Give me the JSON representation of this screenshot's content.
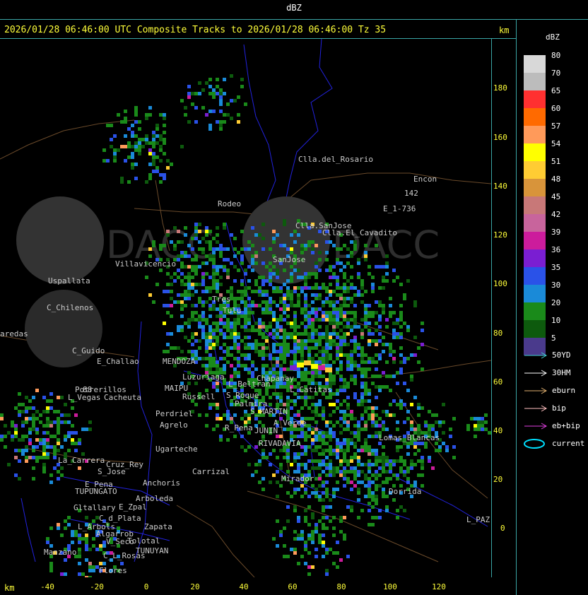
{
  "window": {
    "title": "dBZ"
  },
  "header": {
    "text": "2026/01/28 06:46:00 UTC Composite Tracks to 2026/01/28 06:46:00 Tz 35",
    "unit_top": "km",
    "unit_bottom": "km"
  },
  "axes": {
    "y_ticks": [
      "180",
      "160",
      "140",
      "120",
      "100",
      "80",
      "60",
      "40",
      "20",
      "0"
    ],
    "x_ticks": [
      "-40",
      "-20",
      "0",
      "20",
      "40",
      "60",
      "80",
      "100",
      "120"
    ]
  },
  "legend": {
    "title": "dBZ",
    "levels": [
      {
        "label": "80",
        "color": "#d8d8d8"
      },
      {
        "label": "70",
        "color": "#bcbcbc"
      },
      {
        "label": "65",
        "color": "#ff3030"
      },
      {
        "label": "60",
        "color": "#ff6a00"
      },
      {
        "label": "57",
        "color": "#ff9a5a"
      },
      {
        "label": "54",
        "color": "#ffff00"
      },
      {
        "label": "51",
        "color": "#ffcc33"
      },
      {
        "label": "48",
        "color": "#d8943a"
      },
      {
        "label": "45",
        "color": "#c87878"
      },
      {
        "label": "42",
        "color": "#c8649c"
      },
      {
        "label": "39",
        "color": "#cc1c9c"
      },
      {
        "label": "36",
        "color": "#7a1ed2"
      },
      {
        "label": "35",
        "color": "#2a52e8"
      },
      {
        "label": "30",
        "color": "#1a8ad8"
      },
      {
        "label": "20",
        "color": "#1a8a1a"
      },
      {
        "label": "10",
        "color": "#0d5a0d"
      },
      {
        "label": "5",
        "color": "#4a3a8c"
      }
    ]
  },
  "tracks": [
    {
      "label": "50YD",
      "color": "#40d0d0"
    },
    {
      "label": "30HM",
      "color": "#ffffff"
    },
    {
      "label": "eburn",
      "color": "#e0b070"
    },
    {
      "label": "bip",
      "color": "#ffc0c0"
    },
    {
      "label": "eb+bip",
      "color": "#e040e0"
    },
    {
      "label": "current",
      "color": "#00e0ff"
    }
  ],
  "map": {
    "logo_text_left": "DACC",
    "logo_text_right": "DACC",
    "places": [
      {
        "name": "Clla.del_Rosario"
      },
      {
        "name": "Encon"
      },
      {
        "name": "142"
      },
      {
        "name": "E_1-736"
      },
      {
        "name": "Rodeo"
      },
      {
        "name": "Clla.SanJose"
      },
      {
        "name": "Clla.El_Cavadito"
      },
      {
        "name": "SanJose"
      },
      {
        "name": "Villavicencio"
      },
      {
        "name": "Uspallata"
      },
      {
        "name": "C_Chilenos"
      },
      {
        "name": "aredas"
      },
      {
        "name": "Tres"
      },
      {
        "name": "Tulu"
      },
      {
        "name": "C_Guido"
      },
      {
        "name": "E_Challao"
      },
      {
        "name": "MENDOZA"
      },
      {
        "name": "Potrerillos"
      },
      {
        "name": "L_Vegas"
      },
      {
        "name": "Cacheuta"
      },
      {
        "name": "Luzuriaga"
      },
      {
        "name": "L_Beltran"
      },
      {
        "name": "Chapanay"
      },
      {
        "name": "L_Catitas"
      },
      {
        "name": "MAIPU"
      },
      {
        "name": "Russell"
      },
      {
        "name": "S_Roque"
      },
      {
        "name": "Palmira"
      },
      {
        "name": "S_MARTIN"
      },
      {
        "name": "Perdriel"
      },
      {
        "name": "Agrelo"
      },
      {
        "name": "A_Verde"
      },
      {
        "name": "R_Pena"
      },
      {
        "name": "JUNIN"
      },
      {
        "name": "Lomas_Blancas"
      },
      {
        "name": "Ugarteche"
      },
      {
        "name": "RIVADAVIA"
      },
      {
        "name": "La_Carrera"
      },
      {
        "name": "Cruz_Rey"
      },
      {
        "name": "S_Jose"
      },
      {
        "name": "E_Pena"
      },
      {
        "name": "TUPUNGATO"
      },
      {
        "name": "Anchoris"
      },
      {
        "name": "Carrizal"
      },
      {
        "name": "Mirador"
      },
      {
        "name": "Dorrida"
      },
      {
        "name": "Arboleda"
      },
      {
        "name": "E_Zpal"
      },
      {
        "name": "Gltallary"
      },
      {
        "name": "C_d_Plata"
      },
      {
        "name": "L_Arbols"
      },
      {
        "name": "Algarrob"
      },
      {
        "name": "V_Seco"
      },
      {
        "name": "Zapata"
      },
      {
        "name": "Tolotal"
      },
      {
        "name": "TUNUYAN"
      },
      {
        "name": "C_L_Rosas"
      },
      {
        "name": "Flores"
      },
      {
        "name": "Manzano"
      },
      {
        "name": "L_PAZ"
      },
      {
        "name": "88"
      }
    ]
  }
}
